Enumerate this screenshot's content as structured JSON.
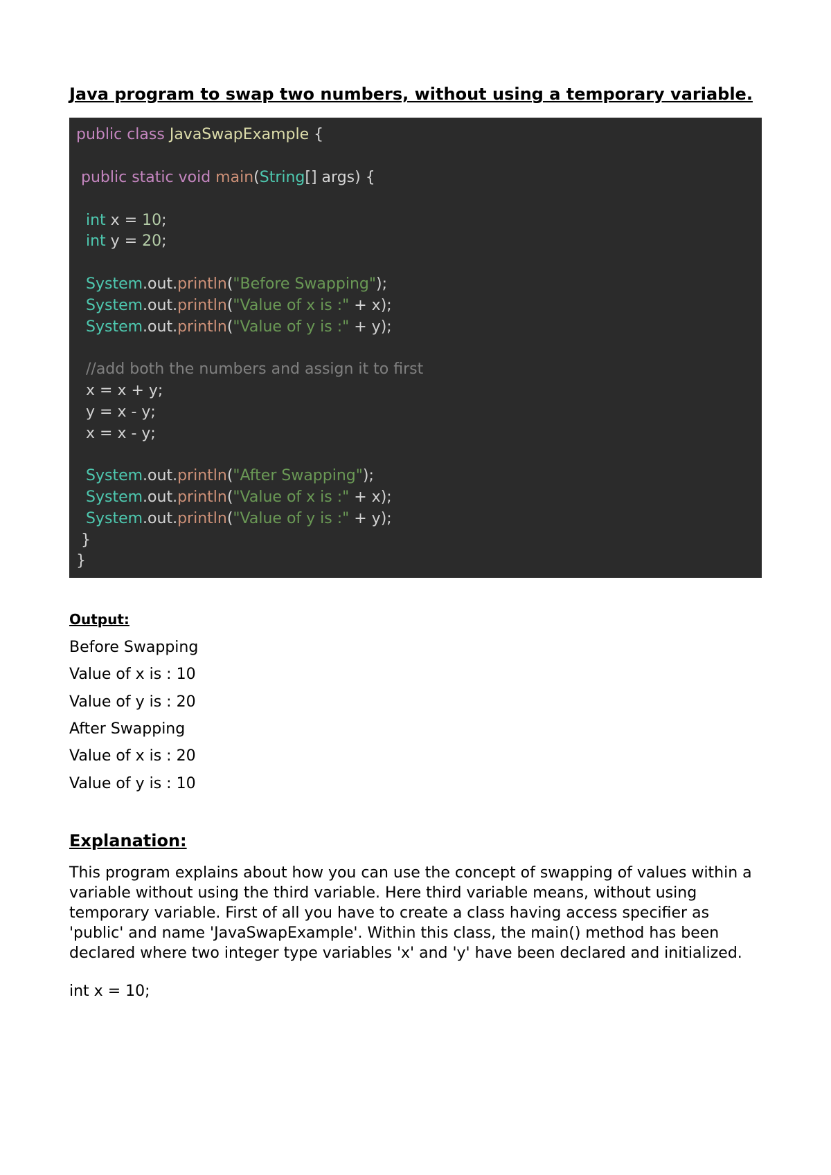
{
  "title": "Java program to swap two numbers, without using a temporary variable.",
  "code": {
    "l1": {
      "kw1": "public",
      "kw2": "class",
      "cls": "JavaSwapExample",
      "open": " {"
    },
    "l2": {
      "kw1": "public",
      "kw2": "static",
      "kw3": "void",
      "m": "main",
      "punc1": "(",
      "type": "String",
      "arr": "[] args) {"
    },
    "l3": {
      "type": "int",
      "rest": " x = ",
      "num": "10",
      "end": ";"
    },
    "l4": {
      "type": "int",
      "rest": " y = ",
      "num": "20",
      "end": ";"
    },
    "l5": {
      "cls": "System",
      "dot1": ".",
      "prop": "out",
      "dot2": ".",
      "m": "println",
      "open": "(",
      "str": "\"Before Swapping\"",
      "close": ");"
    },
    "l6": {
      "cls": "System",
      "dot1": ".",
      "prop": "out",
      "dot2": ".",
      "m": "println",
      "open": "(",
      "str": "\"Value of x is :\"",
      "plus": " + x",
      "close": ");"
    },
    "l7": {
      "cls": "System",
      "dot1": ".",
      "prop": "out",
      "dot2": ".",
      "m": "println",
      "open": "(",
      "str": "\"Value of y is :\"",
      "plus": " + y",
      "close": ");"
    },
    "l8": {
      "comment": "//add both the numbers and assign it to first"
    },
    "l9": {
      "stmt": "x = x + y;"
    },
    "l10": {
      "stmt": "x = x - y;",
      "pre": "y = x - y;"
    },
    "l11": {
      "stmt": "x = x - y;"
    },
    "l12": {
      "cls": "System",
      "dot1": ".",
      "prop": "out",
      "dot2": ".",
      "m": "println",
      "open": "(",
      "str": "\"After Swapping\"",
      "close": ");"
    },
    "l13": {
      "cls": "System",
      "dot1": ".",
      "prop": "out",
      "dot2": ".",
      "m": "println",
      "open": "(",
      "str": "\"Value of x is :\"",
      "plus": " + x",
      "close": ");"
    },
    "l14": {
      "cls": "System",
      "dot1": ".",
      "prop": "out",
      "dot2": ".",
      "m": "println",
      "open": "(",
      "str": "\"Value of y is :\"",
      "plus": " + y",
      "close": ");"
    },
    "l15": {
      "brace": " }"
    },
    "l16": {
      "brace": "}"
    }
  },
  "output": {
    "heading": "Output:",
    "lines": [
      "Before Swapping",
      "Value of x is : 10",
      "Value of y is : 20",
      "After Swapping",
      "Value of x is : 20",
      "Value of y is : 10"
    ]
  },
  "explanation": {
    "heading": "Explanation:",
    "para": "This program explains about how you can use the concept of swapping of values within a variable without using the third variable. Here third variable means, without using temporary variable. First of all you have to create a class having access specifier as 'public' and name 'JavaSwapExample'. Within this class, the main() method has been declared where two integer type variables 'x' and 'y' have been declared and initialized.",
    "snippet": "int x = 10;"
  }
}
